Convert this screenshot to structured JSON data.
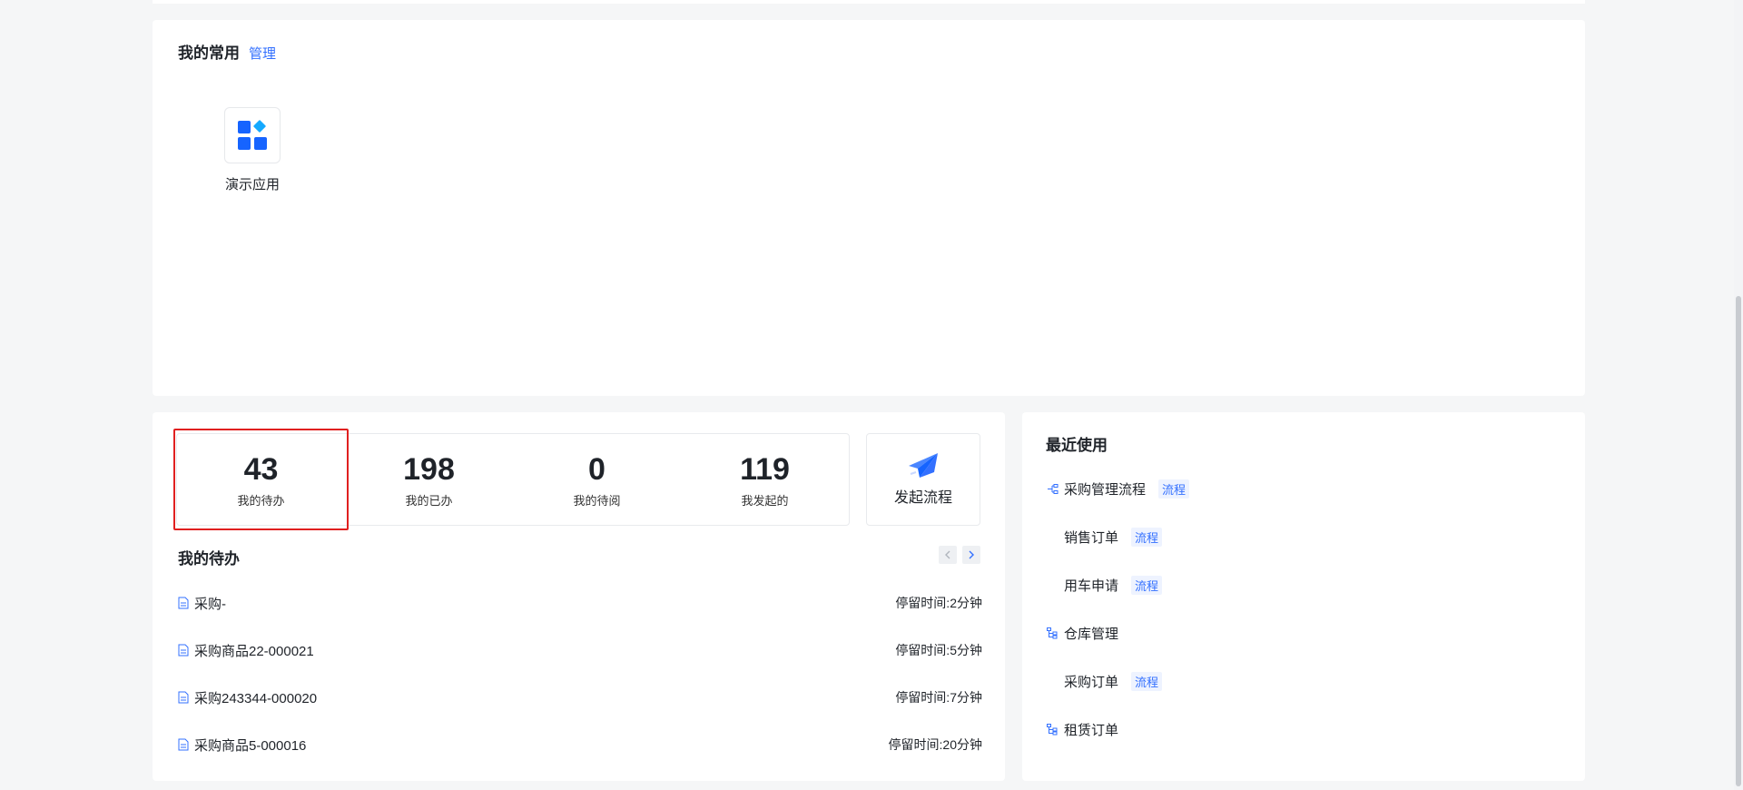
{
  "common": {
    "title": "我的常用",
    "manage_label": "管理",
    "apps": [
      {
        "label": "演示应用",
        "icon": "app-grid-icon"
      }
    ]
  },
  "stats": [
    {
      "value": "43",
      "label": "我的待办",
      "selected": true
    },
    {
      "value": "198",
      "label": "我的已办",
      "selected": false
    },
    {
      "value": "0",
      "label": "我的待阅",
      "selected": false
    },
    {
      "value": "119",
      "label": "我发起的",
      "selected": false
    }
  ],
  "launch": {
    "label": "发起流程",
    "icon": "paper-plane-icon"
  },
  "todo": {
    "title": "我的待办",
    "time_prefix": "停留时间:",
    "items": [
      {
        "name": "采购-",
        "time": "2分钟"
      },
      {
        "name": "采购商品22-000021",
        "time": "5分钟"
      },
      {
        "name": "采购243344-000020",
        "time": "7分钟"
      },
      {
        "name": "采购商品5-000016",
        "time": "20分钟"
      }
    ]
  },
  "recent": {
    "title": "最近使用",
    "items": [
      {
        "name": "采购管理流程",
        "tag": "流程",
        "icon": "flow-icon"
      },
      {
        "name": "销售订单",
        "tag": "流程",
        "icon": ""
      },
      {
        "name": "用车申请",
        "tag": "流程",
        "icon": ""
      },
      {
        "name": "仓库管理",
        "tag": "",
        "icon": "tree-icon"
      },
      {
        "name": "采购订单",
        "tag": "流程",
        "icon": ""
      },
      {
        "name": "租赁订单",
        "tag": "",
        "icon": "tree-icon"
      }
    ]
  },
  "colors": {
    "accent": "#3370ff",
    "selected_border": "#e02020"
  }
}
